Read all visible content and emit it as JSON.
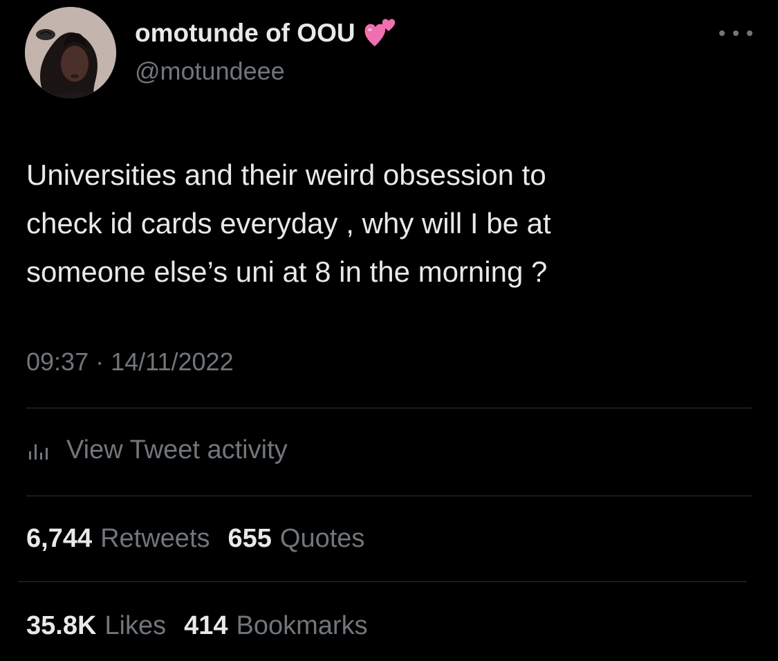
{
  "author": {
    "display_name": "omotunde of OOU",
    "handle": "@motundeee",
    "emoji": "two-hearts-emoji"
  },
  "more_icon": "ellipsis-icon",
  "tweet": {
    "lines": [
      "Universities and their weird obsession to",
      "check id cards everyday , why will I be at",
      "someone else’s uni at 8 in the morning ?"
    ],
    "timestamp": "09:37 · 14/11/2022"
  },
  "activity": {
    "icon": "bar-chart-icon",
    "label": "View Tweet activity"
  },
  "stats": {
    "retweets": {
      "count": "6,744",
      "label": "Retweets"
    },
    "quotes": {
      "count": "655",
      "label": "Quotes"
    },
    "likes": {
      "count": "35.8K",
      "label": "Likes"
    },
    "bookmarks": {
      "count": "414",
      "label": "Bookmarks"
    }
  },
  "colors": {
    "background": "#000000",
    "primary_text": "#e7e9ea",
    "secondary_text": "#71767b",
    "divider": "#2f3336",
    "heart_pink": "#f06fb0"
  }
}
